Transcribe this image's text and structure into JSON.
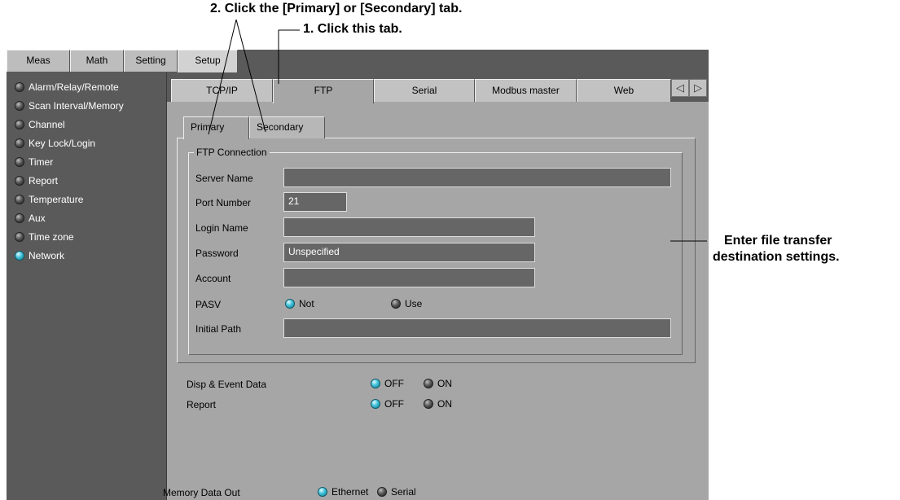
{
  "annotations": {
    "step2": "2. Click the [Primary] or [Secondary] tab.",
    "step1": "1. Click this tab.",
    "right_note_line1": "Enter file transfer",
    "right_note_line2": "destination settings."
  },
  "main_tabs": [
    {
      "label": "Meas",
      "active": false
    },
    {
      "label": "Math",
      "active": false
    },
    {
      "label": "Setting",
      "active": false
    },
    {
      "label": "Setup",
      "active": true
    }
  ],
  "sidebar": {
    "items": [
      {
        "label": "Alarm/Relay/Remote",
        "selected": false
      },
      {
        "label": "Scan Interval/Memory",
        "selected": false
      },
      {
        "label": "Channel",
        "selected": false
      },
      {
        "label": "Key Lock/Login",
        "selected": false
      },
      {
        "label": "Timer",
        "selected": false
      },
      {
        "label": "Report",
        "selected": false
      },
      {
        "label": "Temperature",
        "selected": false
      },
      {
        "label": "Aux",
        "selected": false
      },
      {
        "label": "Time zone",
        "selected": false
      },
      {
        "label": "Network",
        "selected": true
      }
    ]
  },
  "sub_tabs": [
    {
      "label": "TCP/IP",
      "active": false
    },
    {
      "label": "FTP",
      "active": true
    },
    {
      "label": "Serial",
      "active": false
    },
    {
      "label": "Modbus master",
      "active": false
    },
    {
      "label": "Web",
      "active": false
    }
  ],
  "scroll_arrows": {
    "left": "◁",
    "right": "▷"
  },
  "inner_tabs": [
    {
      "label": "Primary",
      "active": true
    },
    {
      "label": "Secondary",
      "active": false
    }
  ],
  "ftp": {
    "group_title": "FTP Connection",
    "server_name_label": "Server Name",
    "server_name_value": "",
    "port_label": "Port Number",
    "port_value": "21",
    "login_label": "Login Name",
    "login_value": "",
    "password_label": "Password",
    "password_value": "Unspecified",
    "account_label": "Account",
    "account_value": "",
    "pasv_label": "PASV",
    "pasv_not": "Not",
    "pasv_use": "Use",
    "pasv_selected": "Not",
    "initial_path_label": "Initial Path",
    "initial_path_value": ""
  },
  "options": {
    "disp_event_label": "Disp & Event Data",
    "disp_off": "OFF",
    "disp_on": "ON",
    "disp_selected": "OFF",
    "report_label": "Report",
    "report_off": "OFF",
    "report_on": "ON",
    "report_selected": "OFF"
  },
  "memory_out": {
    "label": "Memory Data Out",
    "ethernet": "Ethernet",
    "serial": "Serial",
    "selected": "Ethernet"
  },
  "colors": {
    "radio_on": "#3fc0d8",
    "panel_dark": "#5a5a5a",
    "panel_light": "#a6a6a6"
  }
}
